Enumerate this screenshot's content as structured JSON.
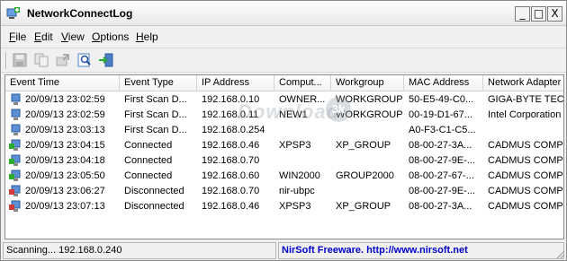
{
  "window": {
    "title": "NetworkConnectLog",
    "min_symbol": "_",
    "max_symbol": "□",
    "close_symbol": "X"
  },
  "menu": [
    {
      "key": "F",
      "rest": "ile"
    },
    {
      "key": "E",
      "rest": "dit"
    },
    {
      "key": "V",
      "rest": "iew"
    },
    {
      "key": "O",
      "rest": "ptions"
    },
    {
      "key": "H",
      "rest": "elp"
    }
  ],
  "toolbar": {
    "icons": [
      "save-icon",
      "copy-icon",
      "export-icon",
      "find-icon",
      "exit-icon"
    ]
  },
  "table": {
    "columns": [
      "Event Time",
      "Event Type",
      "IP Address",
      "Comput...",
      "Workgroup",
      "MAC Address",
      "Network Adapter"
    ],
    "rows": [
      {
        "icon": "computer-scan-icon",
        "cells": [
          "20/09/13 23:02:59",
          "First Scan D...",
          "192.168.0.10",
          "OWNER...",
          "WORKGROUP",
          "50-E5-49-C0...",
          "GIGA-BYTE TECHN"
        ]
      },
      {
        "icon": "computer-scan-icon",
        "cells": [
          "20/09/13 23:02:59",
          "First Scan D...",
          "192.168.0.11",
          "NEW1",
          "WORKGROUP",
          "00-19-D1-67...",
          "Intel Corporation"
        ]
      },
      {
        "icon": "computer-scan-icon",
        "cells": [
          "20/09/13 23:03:13",
          "First Scan D...",
          "192.168.0.254",
          "",
          "",
          "A0-F3-C1-C5...",
          ""
        ]
      },
      {
        "icon": "computer-connected-icon",
        "cells": [
          "20/09/13 23:04:15",
          "Connected",
          "192.168.0.46",
          "XPSP3",
          "XP_GROUP",
          "08-00-27-3A...",
          "CADMUS COMPUT"
        ]
      },
      {
        "icon": "computer-connected-icon",
        "cells": [
          "20/09/13 23:04:18",
          "Connected",
          "192.168.0.70",
          "",
          "",
          "08-00-27-9E-...",
          "CADMUS COMPUT"
        ]
      },
      {
        "icon": "computer-connected-icon",
        "cells": [
          "20/09/13 23:05:50",
          "Connected",
          "192.168.0.60",
          "WIN2000",
          "GROUP2000",
          "08-00-27-67-...",
          "CADMUS COMPUT"
        ]
      },
      {
        "icon": "computer-disconnected-icon",
        "cells": [
          "20/09/13 23:06:27",
          "Disconnected",
          "192.168.0.70",
          "nir-ubpc",
          "",
          "08-00-27-9E-...",
          "CADMUS COMPUT"
        ]
      },
      {
        "icon": "computer-disconnected-icon",
        "cells": [
          "20/09/13 23:07:13",
          "Disconnected",
          "192.168.0.46",
          "XPSP3",
          "XP_GROUP",
          "08-00-27-3A...",
          "CADMUS COMPUT"
        ]
      }
    ]
  },
  "watermark": {
    "text": "Download",
    "badge": "3k"
  },
  "status": {
    "left": "Scanning...    192.168.0.240",
    "right": "NirSoft Freeware.  http://www.nirsoft.net"
  },
  "colors": {
    "scan_icon": "#3a7bd5",
    "connected_icon": "#2eaa2e",
    "disconnected_icon": "#d23a3a",
    "link_text": "#0000cc"
  }
}
